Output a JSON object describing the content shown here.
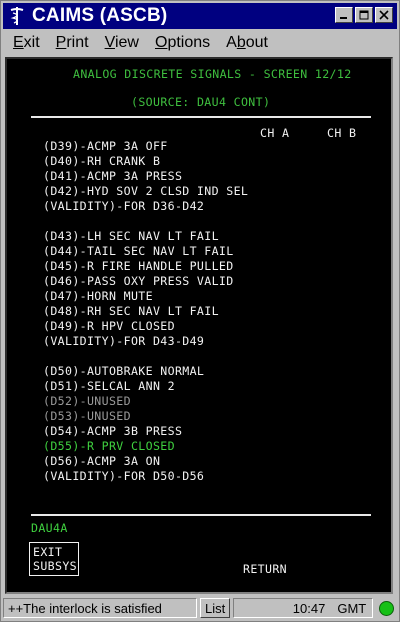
{
  "window": {
    "title": "CAIMS (ASCB)"
  },
  "menu": [
    "Exit",
    "Print",
    "View",
    "Options",
    "About"
  ],
  "menu_accel": [
    "E",
    "P",
    "V",
    "O",
    "b"
  ],
  "screen": {
    "header1": "ANALOG DISCRETE SIGNALS - SCREEN 12/12",
    "header2": "(SOURCE: DAU4 CONT)",
    "ch_a": "CH A",
    "ch_b": "CH B",
    "group1": [
      "(D39)-ACMP 3A OFF",
      "(D40)-RH CRANK B",
      "(D41)-ACMP 3A PRESS",
      "(D42)-HYD SOV 2 CLSD IND SEL",
      "(VALIDITY)-FOR D36-D42"
    ],
    "group2": [
      "(D43)-LH SEC NAV LT FAIL",
      "(D44)-TAIL SEC NAV LT FAIL",
      "(D45)-R FIRE HANDLE PULLED",
      "(D46)-PASS OXY PRESS VALID",
      "(D47)-HORN MUTE",
      "(D48)-RH SEC NAV LT FAIL",
      "(D49)-R HPV CLOSED",
      "(VALIDITY)-FOR D43-D49"
    ],
    "group3": [
      "(D50)-AUTOBRAKE NORMAL",
      "(D51)-SELCAL ANN 2",
      "(D52)-UNUSED",
      "(D53)-UNUSED",
      "(D54)-ACMP 3B PRESS",
      "(D55)-R PRV CLOSED",
      "(D56)-ACMP 3A ON",
      "(VALIDITY)-FOR D50-D56"
    ],
    "dau_label": "DAU4A",
    "exit_line1": "EXIT",
    "exit_line2": "SUBSYS",
    "return_label": "RETURN"
  },
  "status": {
    "message": "++The interlock is satisfied",
    "list_label": "List",
    "time": "10:47",
    "timezone": "GMT"
  },
  "colors": {
    "header_green": "#3fbf3f",
    "highlight_green": "#3fd03f",
    "dim_gray": "#9a9a9a",
    "title_blue": "#000080"
  }
}
